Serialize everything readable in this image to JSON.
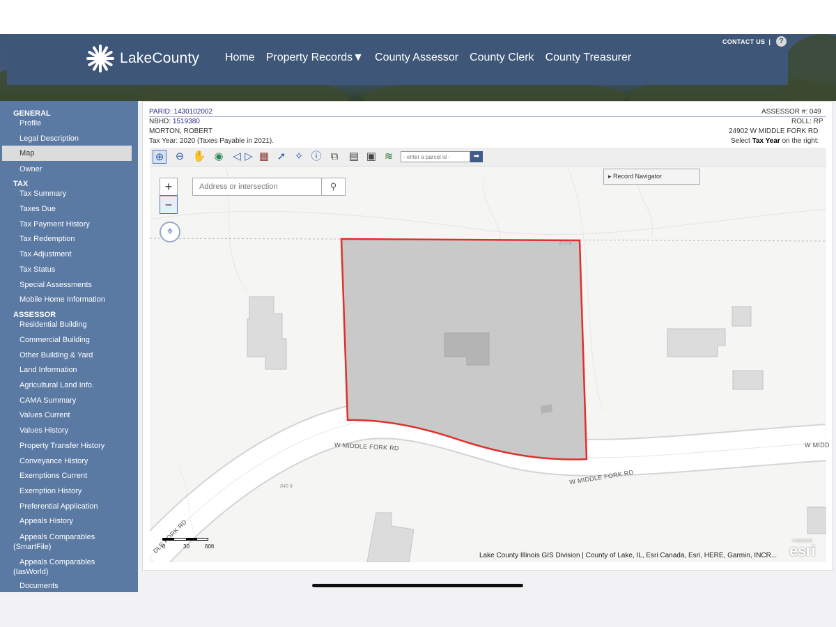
{
  "header": {
    "brand": "LakeCounty",
    "nav": [
      "Home",
      "Property Records▼",
      "County Assessor",
      "County Clerk",
      "County Treasurer"
    ],
    "contact": "CONTACT US",
    "contact_sep": "|",
    "help": "?"
  },
  "sidebar": {
    "sections": [
      {
        "title": "GENERAL",
        "items": [
          "Profile",
          "Legal Description",
          "Map",
          "Owner"
        ]
      },
      {
        "title": "TAX",
        "items": [
          "Tax Summary",
          "Taxes Due",
          "Tax Payment History",
          "Tax Redemption",
          "Tax Adjustment",
          "Tax Status",
          "Special Assessments",
          "Mobile Home Information"
        ]
      },
      {
        "title": "ASSESSOR",
        "items": [
          "Residential Building",
          "Commercial Building",
          "Other Building & Yard",
          "Land Information",
          "Agricultural Land Info.",
          "CAMA Summary",
          "Values Current",
          "Values History",
          "Property Transfer History",
          "Conveyance History",
          "Exemptions Current",
          "Exemption History",
          "Preferential Application",
          "Appeals History"
        ]
      }
    ],
    "active": "Map",
    "multiline": {
      "appeals_smartfile_1": "Appeals Comparables",
      "appeals_smartfile_2": "(SmartFile)",
      "appeals_iasworld_1": "Appeals Comparables",
      "appeals_iasworld_2": "(IasWorld)",
      "documents": "Documents"
    }
  },
  "parcel": {
    "parid_label": "PARID:",
    "parid": "1430102002",
    "nbhd_label": "NBHD:",
    "nbhd": "1519380",
    "owner": "MORTON, ROBERT",
    "tax_year": "Tax Year: 2020 (Taxes Payable in 2021).",
    "assessor": "ASSESSOR #: 049",
    "roll": "ROLL: RP",
    "address": "24902 W MIDDLE FORK RD",
    "select_pre": "Select",
    "select_bold": "Tax Year",
    "select_post": "on the right:"
  },
  "toolbar": {
    "tools": [
      "zoom-in-icon",
      "zoom-out-icon",
      "pan-hand-icon",
      "globe-icon",
      "back-arrow-icon",
      "forward-arrow-icon",
      "map-layer-icon",
      "select-arrow-icon",
      "select-tool-icon",
      "info-icon",
      "buffer-icon",
      "print-icon",
      "screen-icon",
      "layers-icon"
    ],
    "parcel_placeholder": "- enter a parcel id -",
    "go": "➡"
  },
  "map": {
    "search_placeholder": "Address or intersection",
    "record_navigator": "▸ Record Navigator",
    "zoom_in": "+",
    "zoom_out": "−",
    "locate": "⌖",
    "roads": [
      "W MIDDLE FORK RD",
      "W MIDDLE FORK RD",
      "W MIDD",
      "DLE FORK RD"
    ],
    "elevations": [
      "872 ft",
      "840 ft"
    ],
    "scale_labels": [
      "0",
      "30",
      "60ft"
    ],
    "attribution": "Lake County Illinois GIS Division | County of Lake, IL, Esri Canada, Esri, HERE, Garmin, INCR...",
    "esri": "esri",
    "esri_small": "POWERED BY"
  }
}
